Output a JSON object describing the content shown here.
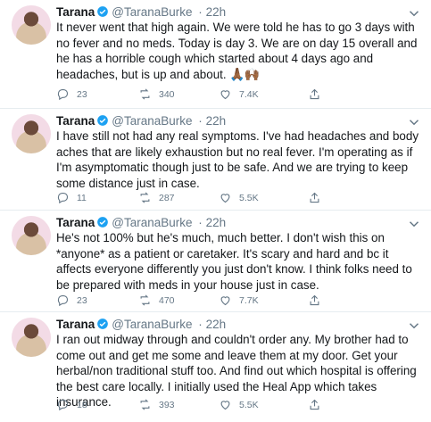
{
  "tweets": [
    {
      "name": "Tarana",
      "handle": "@TaranaBurke",
      "sep": "·",
      "time": "22h",
      "text": "It never went that high again. We were told he has to go 3 days with no fever and no meds. Today is day 3. We are on day 15 overall and he has a horrible cough which started about 4 days ago and headaches, but is up and about.",
      "emoji": "🙏🏾🙌🏾",
      "replies": "23",
      "retweets": "340",
      "likes": "7.4K"
    },
    {
      "name": "Tarana",
      "handle": "@TaranaBurke",
      "sep": "·",
      "time": "22h",
      "text": "I have still not had any real symptoms. I've had headaches and body aches that are likely exhaustion but no real fever. I'm operating as if I'm asymptomatic though just to be safe. And we are trying to keep some distance just in case.",
      "replies": "11",
      "retweets": "287",
      "likes": "5.5K"
    },
    {
      "name": "Tarana",
      "handle": "@TaranaBurke",
      "sep": "·",
      "time": "22h",
      "text": "He's not 100% but he's much, much better. I don't wish this on *anyone* as a patient or caretaker. It's scary and hard and bc it affects everyone differently you just don't know. I think folks need to be prepared with meds in your house just in case.",
      "replies": "23",
      "retweets": "470",
      "likes": "7.7K"
    },
    {
      "name": "Tarana",
      "handle": "@TaranaBurke",
      "sep": "·",
      "time": "22h",
      "text": "I ran out midway through and couldn't order any. My brother had to come out and get me some and leave them at my door. Get your herbal/non traditional stuff too. And find out which hospital is offering the best care locally. I initially used the Heal App which takes insurance.",
      "replies": "18",
      "retweets": "393",
      "likes": "5.5K"
    }
  ],
  "icons": {
    "reply": "reply-icon",
    "retweet": "retweet-icon",
    "like": "heart-icon",
    "share": "share-icon",
    "verified": "verified-badge-icon",
    "more": "chevron-down-icon"
  },
  "colors": {
    "accent": "#1da1f2",
    "muted": "#657786",
    "text": "#14171a",
    "avatar_bg": "#f3dbe6"
  }
}
